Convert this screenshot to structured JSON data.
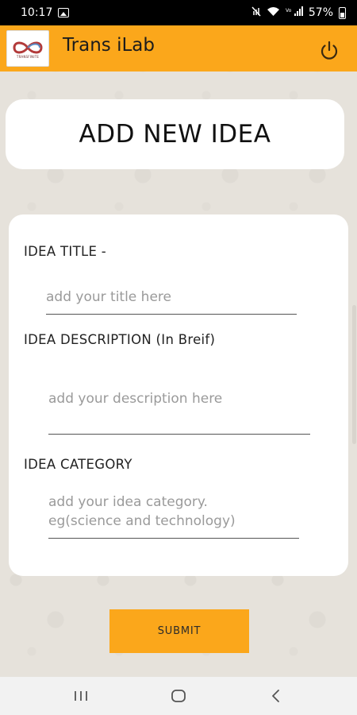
{
  "status_bar": {
    "time": "10:17",
    "battery": "57%"
  },
  "app_bar": {
    "title": "Trans iLab",
    "logo_text": "TRANSFINITE"
  },
  "header": {
    "title": "ADD NEW IDEA"
  },
  "form": {
    "title_label": "IDEA TITLE  -",
    "title_placeholder": "add your title here",
    "description_label": "IDEA DESCRIPTION (In Breif)",
    "description_placeholder": "add your description here",
    "category_label": "IDEA CATEGORY",
    "category_placeholder": "add your idea category.\neg(science and technology)"
  },
  "submit_label": "SUBMIT",
  "colors": {
    "accent": "#fba71b",
    "background": "#e6e2db"
  },
  "icons": [
    "image-icon",
    "power-icon",
    "recents-icon",
    "home-icon",
    "back-icon"
  ]
}
